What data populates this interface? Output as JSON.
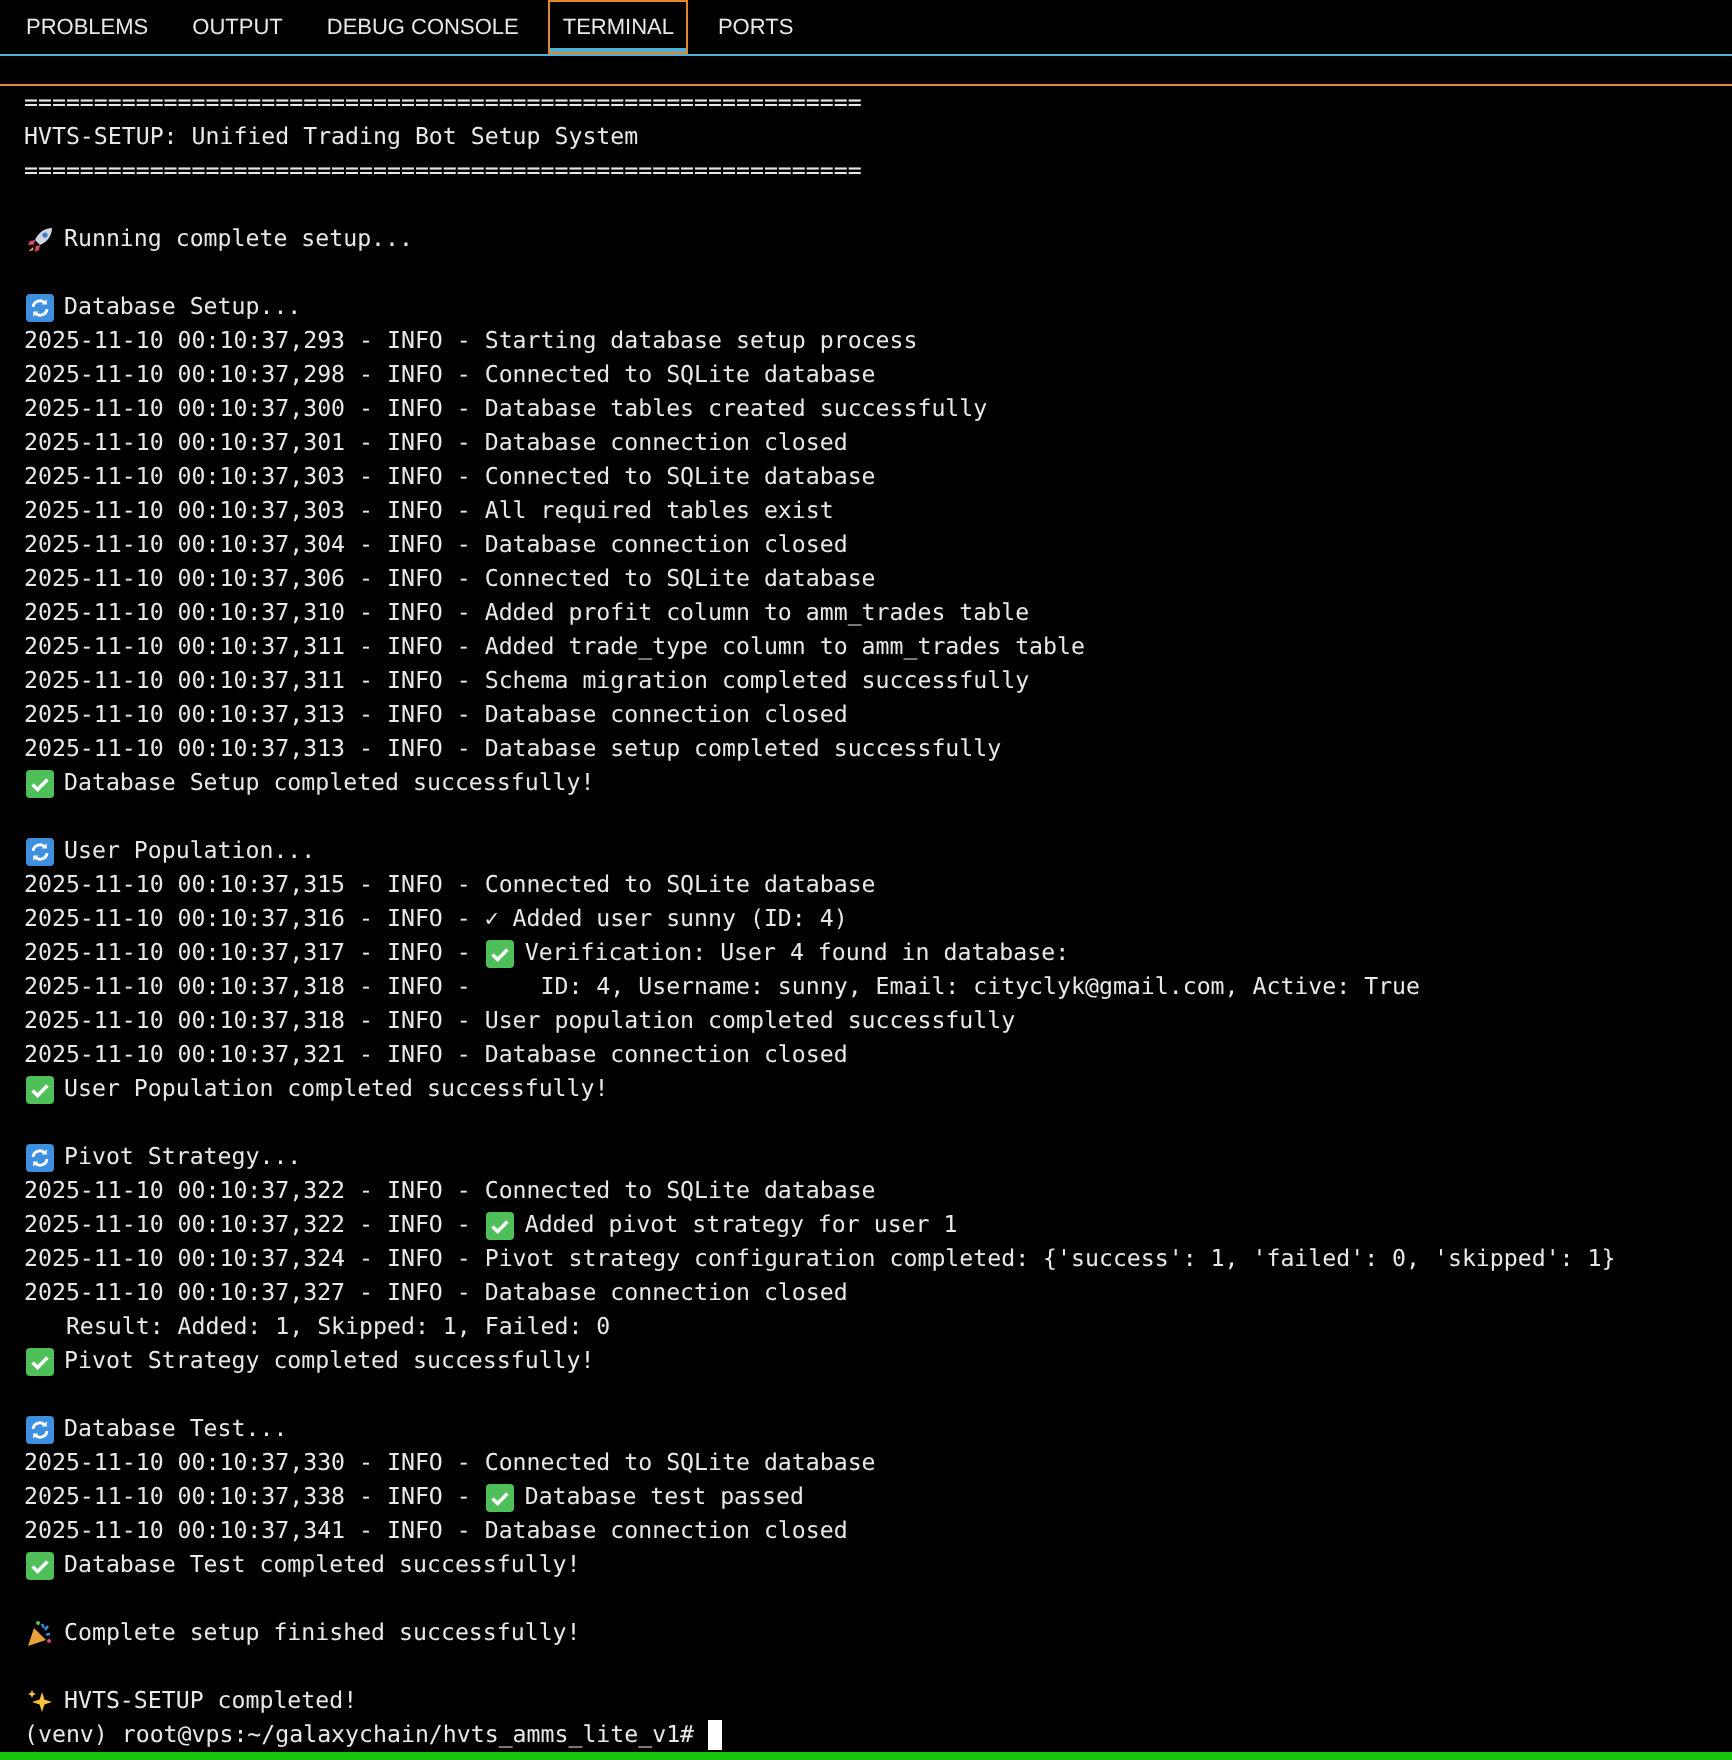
{
  "tabs": [
    {
      "label": "PROBLEMS",
      "selected": false
    },
    {
      "label": "OUTPUT",
      "selected": false
    },
    {
      "label": "DEBUG CONSOLE",
      "selected": false
    },
    {
      "label": "TERMINAL",
      "selected": true
    },
    {
      "label": "PORTS",
      "selected": false
    }
  ],
  "terminal": {
    "lines": [
      {
        "kind": "text",
        "text": "============================================================"
      },
      {
        "kind": "text",
        "text": "HVTS-SETUP: Unified Trading Bot Setup System"
      },
      {
        "kind": "text",
        "text": "============================================================"
      },
      {
        "kind": "blank"
      },
      {
        "kind": "rocket",
        "text": "Running complete setup..."
      },
      {
        "kind": "blank"
      },
      {
        "kind": "refresh",
        "text": "Database Setup..."
      },
      {
        "kind": "text",
        "text": "2025-11-10 00:10:37,293 - INFO - Starting database setup process"
      },
      {
        "kind": "text",
        "text": "2025-11-10 00:10:37,298 - INFO - Connected to SQLite database"
      },
      {
        "kind": "text",
        "text": "2025-11-10 00:10:37,300 - INFO - Database tables created successfully"
      },
      {
        "kind": "text",
        "text": "2025-11-10 00:10:37,301 - INFO - Database connection closed"
      },
      {
        "kind": "text",
        "text": "2025-11-10 00:10:37,303 - INFO - Connected to SQLite database"
      },
      {
        "kind": "text",
        "text": "2025-11-10 00:10:37,303 - INFO - All required tables exist"
      },
      {
        "kind": "text",
        "text": "2025-11-10 00:10:37,304 - INFO - Database connection closed"
      },
      {
        "kind": "text",
        "text": "2025-11-10 00:10:37,306 - INFO - Connected to SQLite database"
      },
      {
        "kind": "text",
        "text": "2025-11-10 00:10:37,310 - INFO - Added profit column to amm_trades table"
      },
      {
        "kind": "text",
        "text": "2025-11-10 00:10:37,311 - INFO - Added trade_type column to amm_trades table"
      },
      {
        "kind": "text",
        "text": "2025-11-10 00:10:37,311 - INFO - Schema migration completed successfully"
      },
      {
        "kind": "text",
        "text": "2025-11-10 00:10:37,313 - INFO - Database connection closed"
      },
      {
        "kind": "text",
        "text": "2025-11-10 00:10:37,313 - INFO - Database setup completed successfully"
      },
      {
        "kind": "check",
        "text": "Database Setup completed successfully!"
      },
      {
        "kind": "blank"
      },
      {
        "kind": "refresh",
        "text": "User Population..."
      },
      {
        "kind": "text",
        "text": "2025-11-10 00:10:37,315 - INFO - Connected to SQLite database"
      },
      {
        "kind": "text",
        "text": "2025-11-10 00:10:37,316 - INFO - ✓ Added user sunny (ID: 4)"
      },
      {
        "kind": "check_log",
        "prefix": "2025-11-10 00:10:37,317 - INFO - ",
        "text": "Verification: User 4 found in database:"
      },
      {
        "kind": "text",
        "text": "2025-11-10 00:10:37,318 - INFO -     ID: 4, Username: sunny, Email: cityclyk@gmail.com, Active: True"
      },
      {
        "kind": "text",
        "text": "2025-11-10 00:10:37,318 - INFO - User population completed successfully"
      },
      {
        "kind": "text",
        "text": "2025-11-10 00:10:37,321 - INFO - Database connection closed"
      },
      {
        "kind": "check",
        "text": "User Population completed successfully!"
      },
      {
        "kind": "blank"
      },
      {
        "kind": "refresh",
        "text": "Pivot Strategy..."
      },
      {
        "kind": "text",
        "text": "2025-11-10 00:10:37,322 - INFO - Connected to SQLite database"
      },
      {
        "kind": "check_log",
        "prefix": "2025-11-10 00:10:37,322 - INFO - ",
        "text": "Added pivot strategy for user 1"
      },
      {
        "kind": "text",
        "text": "2025-11-10 00:10:37,324 - INFO - Pivot strategy configuration completed: {'success': 1, 'failed': 0, 'skipped': 1}"
      },
      {
        "kind": "text",
        "text": "2025-11-10 00:10:37,327 - INFO - Database connection closed"
      },
      {
        "kind": "text",
        "text": "   Result: Added: 1, Skipped: 1, Failed: 0"
      },
      {
        "kind": "check",
        "text": "Pivot Strategy completed successfully!"
      },
      {
        "kind": "blank"
      },
      {
        "kind": "refresh",
        "text": "Database Test..."
      },
      {
        "kind": "text",
        "text": "2025-11-10 00:10:37,330 - INFO - Connected to SQLite database"
      },
      {
        "kind": "check_log",
        "prefix": "2025-11-10 00:10:37,338 - INFO - ",
        "text": "Database test passed"
      },
      {
        "kind": "text",
        "text": "2025-11-10 00:10:37,341 - INFO - Database connection closed"
      },
      {
        "kind": "check",
        "text": "Database Test completed successfully!"
      },
      {
        "kind": "blank"
      },
      {
        "kind": "party",
        "text": "Complete setup finished successfully!"
      },
      {
        "kind": "blank"
      },
      {
        "kind": "sparkles",
        "text": "HVTS-SETUP completed!"
      }
    ],
    "prompt": "(venv) root@vps:~/galaxychain/hvts_amms_lite_v1#"
  }
}
